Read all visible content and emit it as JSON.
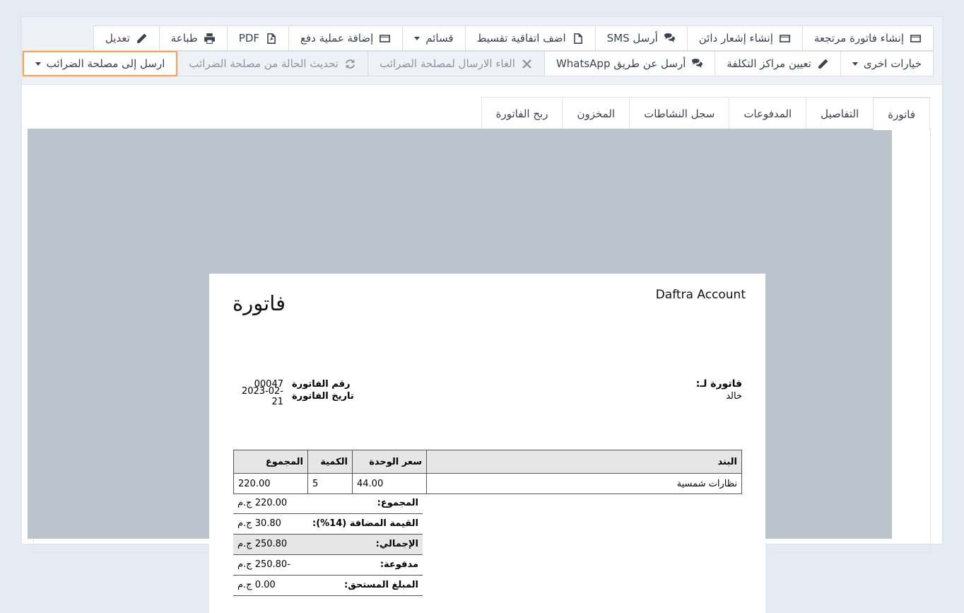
{
  "toolbar": {
    "row1": [
      {
        "label": "تعديل",
        "icon": "pencil-icon"
      },
      {
        "label": "طباعة",
        "icon": "print-icon"
      },
      {
        "label": "PDF",
        "icon": "pdf-icon"
      },
      {
        "label": "إضافة عملية دفع",
        "icon": "credit-card-icon"
      },
      {
        "label": "قسائم",
        "dropdown": true
      },
      {
        "label": "اضف اتفاقية تقسيط",
        "icon": "file-icon"
      },
      {
        "label": "أرسل SMS",
        "icon": "comments-icon"
      },
      {
        "label": "إنشاء إشعار دائن",
        "icon": "credit-card-icon"
      },
      {
        "label": "إنشاء فاتورة مرتجعة",
        "icon": "credit-card-icon"
      }
    ],
    "row2": [
      {
        "label": "ارسل إلى مصلحة الضرائب",
        "dropdown": true,
        "highlighted": true
      },
      {
        "label": "تحديث الحالة من مصلحة الضرائب",
        "icon": "refresh-icon",
        "disabled": true
      },
      {
        "label": "الغاء الارسال لمصلحة الضرائب",
        "icon": "close-icon",
        "disabled": true
      },
      {
        "label": "أرسل عن طريق WhatsApp",
        "icon": "comments-icon"
      },
      {
        "label": "تعيين مراكز التكلفة",
        "icon": "pencil-icon"
      },
      {
        "label": "خيارات اخرى",
        "dropdown": true
      }
    ]
  },
  "tabs": [
    "فاتورة",
    "التفاصيل",
    "المدفوعات",
    "سجل النشاطات",
    "المخزون",
    "ربح الفاتورة"
  ],
  "invoice": {
    "company": "Daftra Account",
    "title": "فاتورة",
    "bill_to_label": "فاتورة لـ:",
    "bill_to_name": "خالد",
    "number_label": "رقم الفاتورة",
    "number": "00047",
    "date_label": "تاريخ الفاتورة",
    "date": "2023-02-21",
    "columns": {
      "item": "البند",
      "unit_price": "سعر الوحدة",
      "qty": "الكمية",
      "total": "المجموع"
    },
    "rows": [
      {
        "item": "نظارات شمسية",
        "unit_price": "44.00",
        "qty": "5",
        "total": "220.00"
      }
    ],
    "totals": [
      {
        "label": "المجموع:",
        "value": "220.00 ج.م"
      },
      {
        "label": "القيمة المضافة (14%):",
        "value": "30.80 ج.م"
      },
      {
        "label": "الإجمالي:",
        "value": "250.80 ج.م",
        "shaded": true
      },
      {
        "label": "مدفوعة:",
        "value": "-250.80 ج.م"
      },
      {
        "label": "المبلغ المستحق:",
        "value": "0.00 ج.م"
      }
    ]
  },
  "colors": {
    "accent_highlight": "#f4a460",
    "background": "#e4ebf3",
    "paper_surround": "#bbc3cd"
  }
}
